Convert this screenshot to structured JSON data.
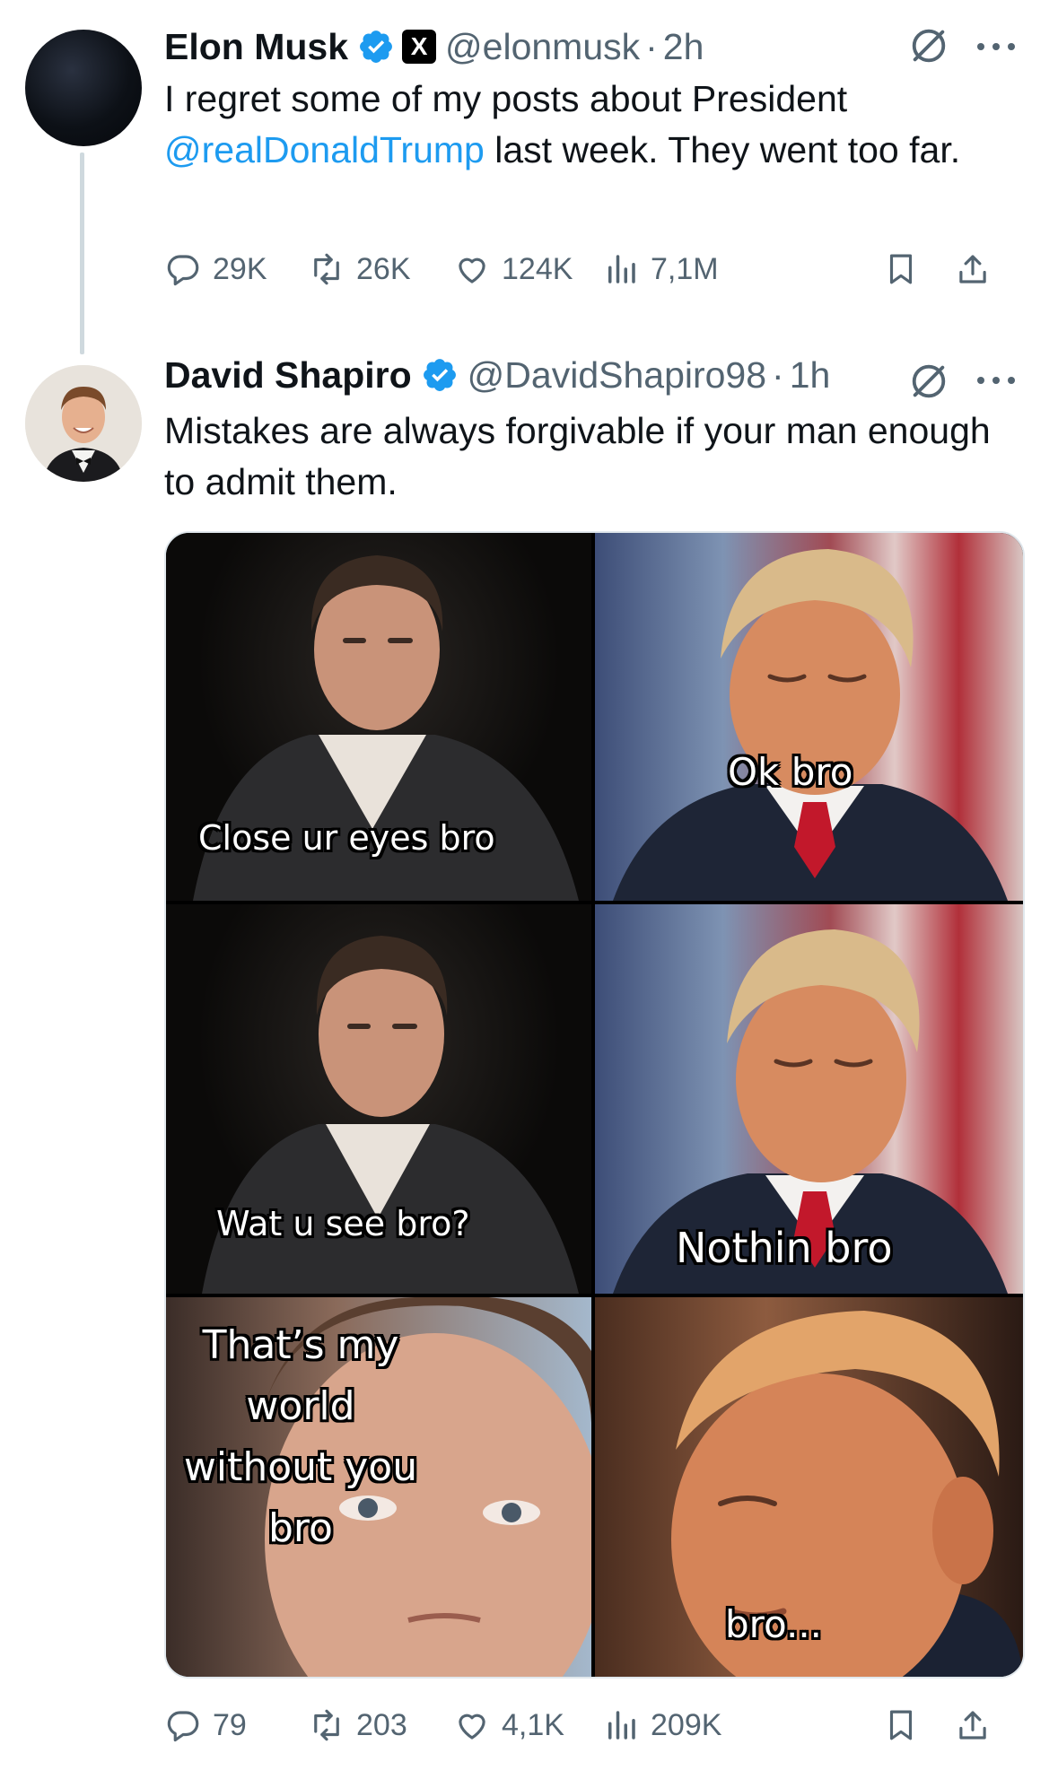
{
  "tweets": [
    {
      "author": "Elon Musk",
      "handle": "@elonmusk",
      "time": "2h",
      "text_before": "I regret some of my posts about President ",
      "mention": "@realDonaldTrump",
      "text_after": " last week. They went too far.",
      "stats": {
        "replies": "29K",
        "reposts": "26K",
        "likes": "124K",
        "views": "7,1M"
      }
    },
    {
      "author": "David Shapiro",
      "handle": "@DavidShapiro98",
      "time": "1h",
      "text": "Mistakes are always forgivable if your man enough to admit them.",
      "media_captions": [
        "Close ur eyes bro",
        "Ok bro",
        "Wat u see bro?",
        "Nothin bro",
        "That’s my world without you bro",
        "bro..."
      ],
      "stats": {
        "replies": "79",
        "reposts": "203",
        "likes": "4,1K",
        "views": "209K"
      }
    }
  ],
  "separator": "·",
  "x_badge": "X",
  "colors": {
    "link": "#1d9bf0",
    "secondary": "#536471",
    "verified": "#1d9bf0"
  },
  "icons": [
    "verified-icon",
    "grok-icon",
    "more-icon",
    "reply-icon",
    "repost-icon",
    "like-icon",
    "views-icon",
    "bookmark-icon",
    "share-icon"
  ]
}
